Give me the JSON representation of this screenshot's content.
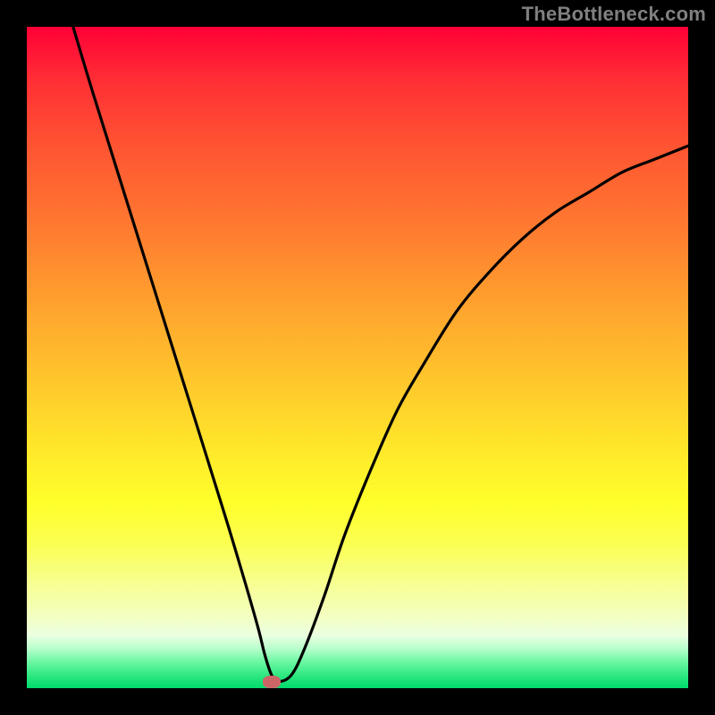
{
  "watermark": "TheBottleneck.com",
  "chart_data": {
    "type": "line",
    "title": "",
    "xlabel": "",
    "ylabel": "",
    "xlim": [
      0,
      100
    ],
    "ylim": [
      0,
      100
    ],
    "grid": false,
    "series": [
      {
        "name": "bottleneck-curve",
        "x": [
          7,
          10,
          15,
          20,
          25,
          30,
          33,
          35,
          36,
          37,
          38,
          40,
          42,
          45,
          48,
          52,
          56,
          60,
          65,
          70,
          75,
          80,
          85,
          90,
          95,
          100
        ],
        "y": [
          100,
          90,
          74,
          58,
          42,
          26,
          16,
          9,
          5,
          2,
          1,
          2,
          6,
          14,
          23,
          33,
          42,
          49,
          57,
          63,
          68,
          72,
          75,
          78,
          80,
          82
        ]
      }
    ],
    "marker": {
      "x": 37,
      "y": 1,
      "color": "#cc6666"
    },
    "gradient_stops": [
      {
        "pos": 0,
        "color": "#ff0036"
      },
      {
        "pos": 50,
        "color": "#ffc82c"
      },
      {
        "pos": 75,
        "color": "#ffff2b"
      },
      {
        "pos": 100,
        "color": "#00db6c"
      }
    ]
  }
}
